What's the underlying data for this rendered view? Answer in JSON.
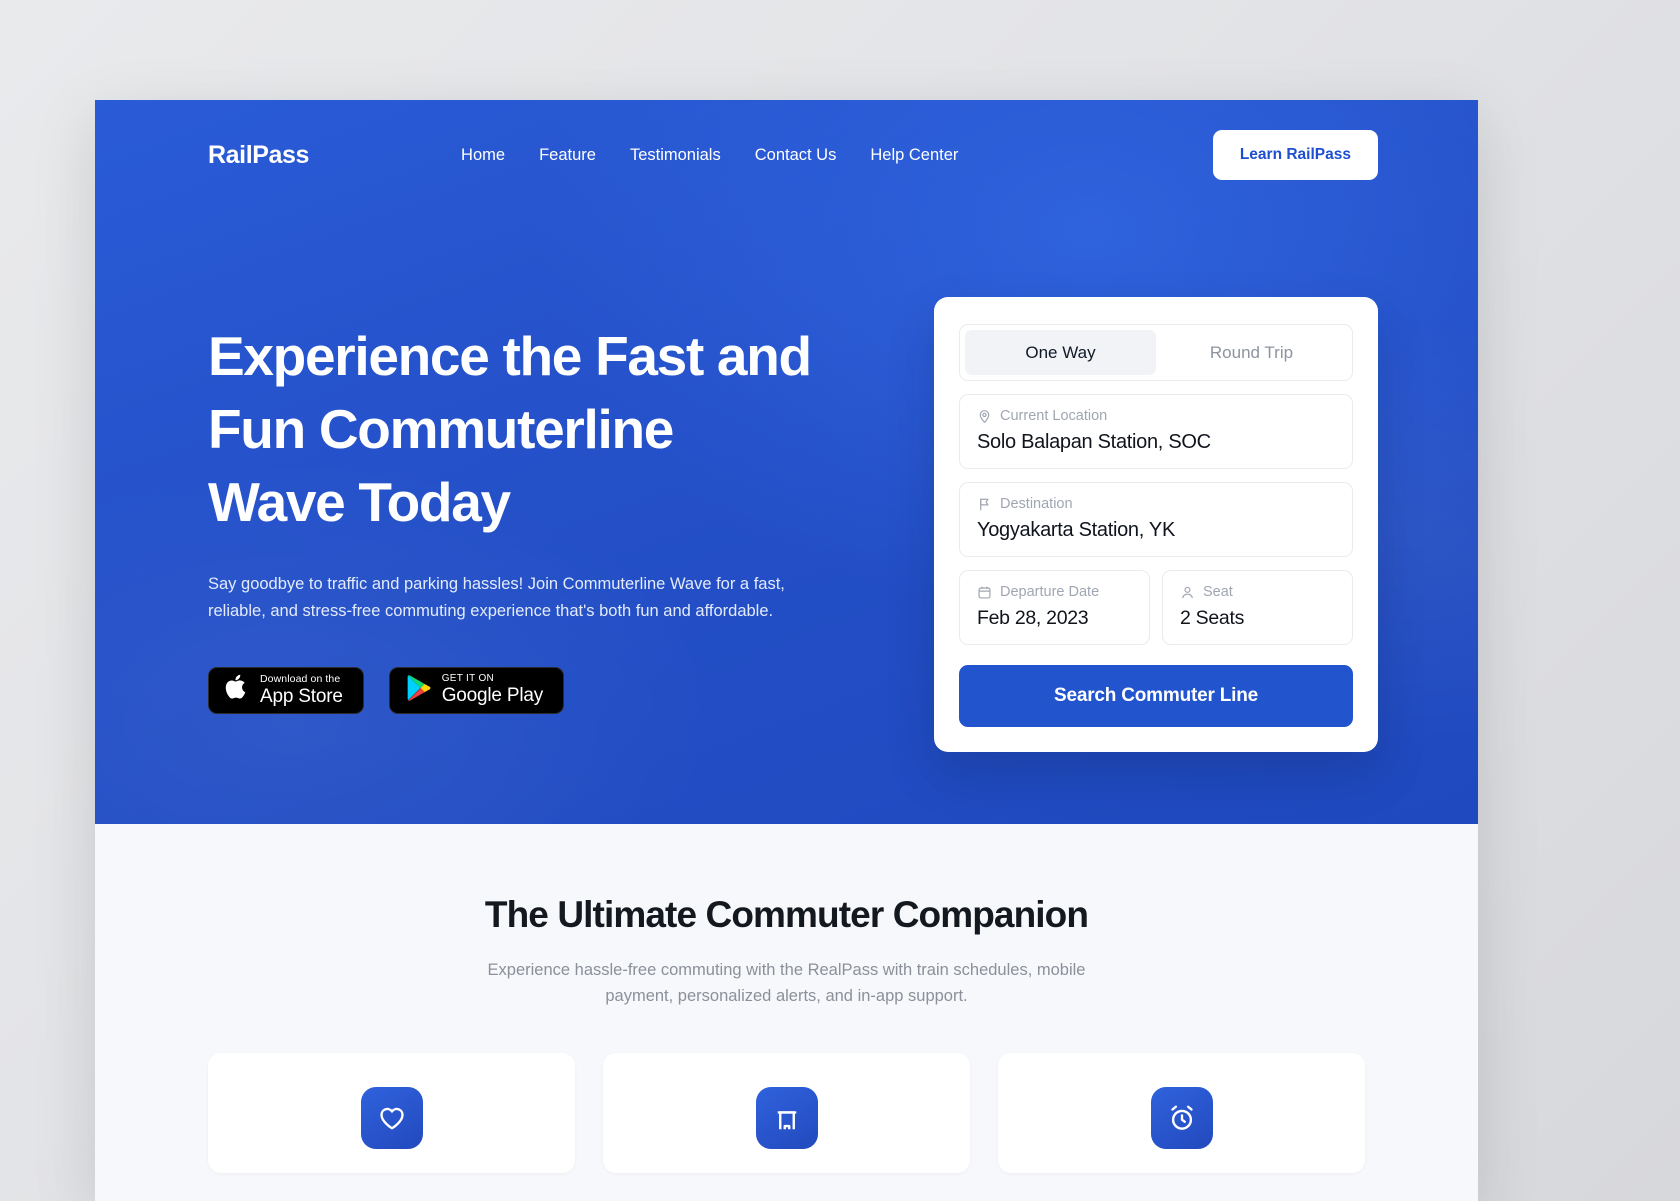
{
  "nav": {
    "brand": "RailPass",
    "links": [
      {
        "label": "Home"
      },
      {
        "label": "Feature"
      },
      {
        "label": "Testimonials"
      },
      {
        "label": "Contact Us"
      },
      {
        "label": "Help Center"
      }
    ],
    "cta_label": "Learn RailPass"
  },
  "hero": {
    "title_line1": "Experience the Fast and",
    "title_line2": "Fun Commuterline",
    "title_line3": "Wave Today",
    "subtitle": "Say goodbye to traffic and parking hassles! Join Commuterline Wave for a fast, reliable, and stress-free commuting experience that's both fun and affordable.",
    "badges": [
      {
        "icon": "apple-icon",
        "top": "Download on the",
        "bottom": "App Store"
      },
      {
        "icon": "google-play-icon",
        "top": "GET IT ON",
        "bottom": "Google Play"
      }
    ]
  },
  "booking": {
    "tabs": [
      {
        "label": "One Way",
        "active": true
      },
      {
        "label": "Round Trip",
        "active": false
      }
    ],
    "origin": {
      "icon": "map-pin-icon",
      "label": "Current Location",
      "value": "Solo Balapan Station, SOC"
    },
    "destination": {
      "icon": "flag-icon",
      "label": "Destination",
      "value": "Yogyakarta Station, YK"
    },
    "departure": {
      "icon": "calendar-icon",
      "label": "Departure Date",
      "value": "Feb 28, 2023"
    },
    "seat": {
      "icon": "person-icon",
      "label": "Seat",
      "value": "2 Seats"
    },
    "search_label": "Search Commuter Line"
  },
  "features": {
    "title": "The Ultimate Commuter Companion",
    "subtitle": "Experience hassle-free commuting with the RealPass with train schedules, mobile payment, personalized alerts, and in-app support.",
    "cards": [
      {
        "icon": "heart-icon"
      },
      {
        "icon": "building-icon"
      },
      {
        "icon": "alarm-clock-icon"
      }
    ]
  },
  "colors": {
    "brand_blue": "#2254cd",
    "hero_blue": "#2450c8",
    "section_bg": "#f7f8fb",
    "text_dark": "#10141c",
    "text_muted": "#8b9099"
  }
}
